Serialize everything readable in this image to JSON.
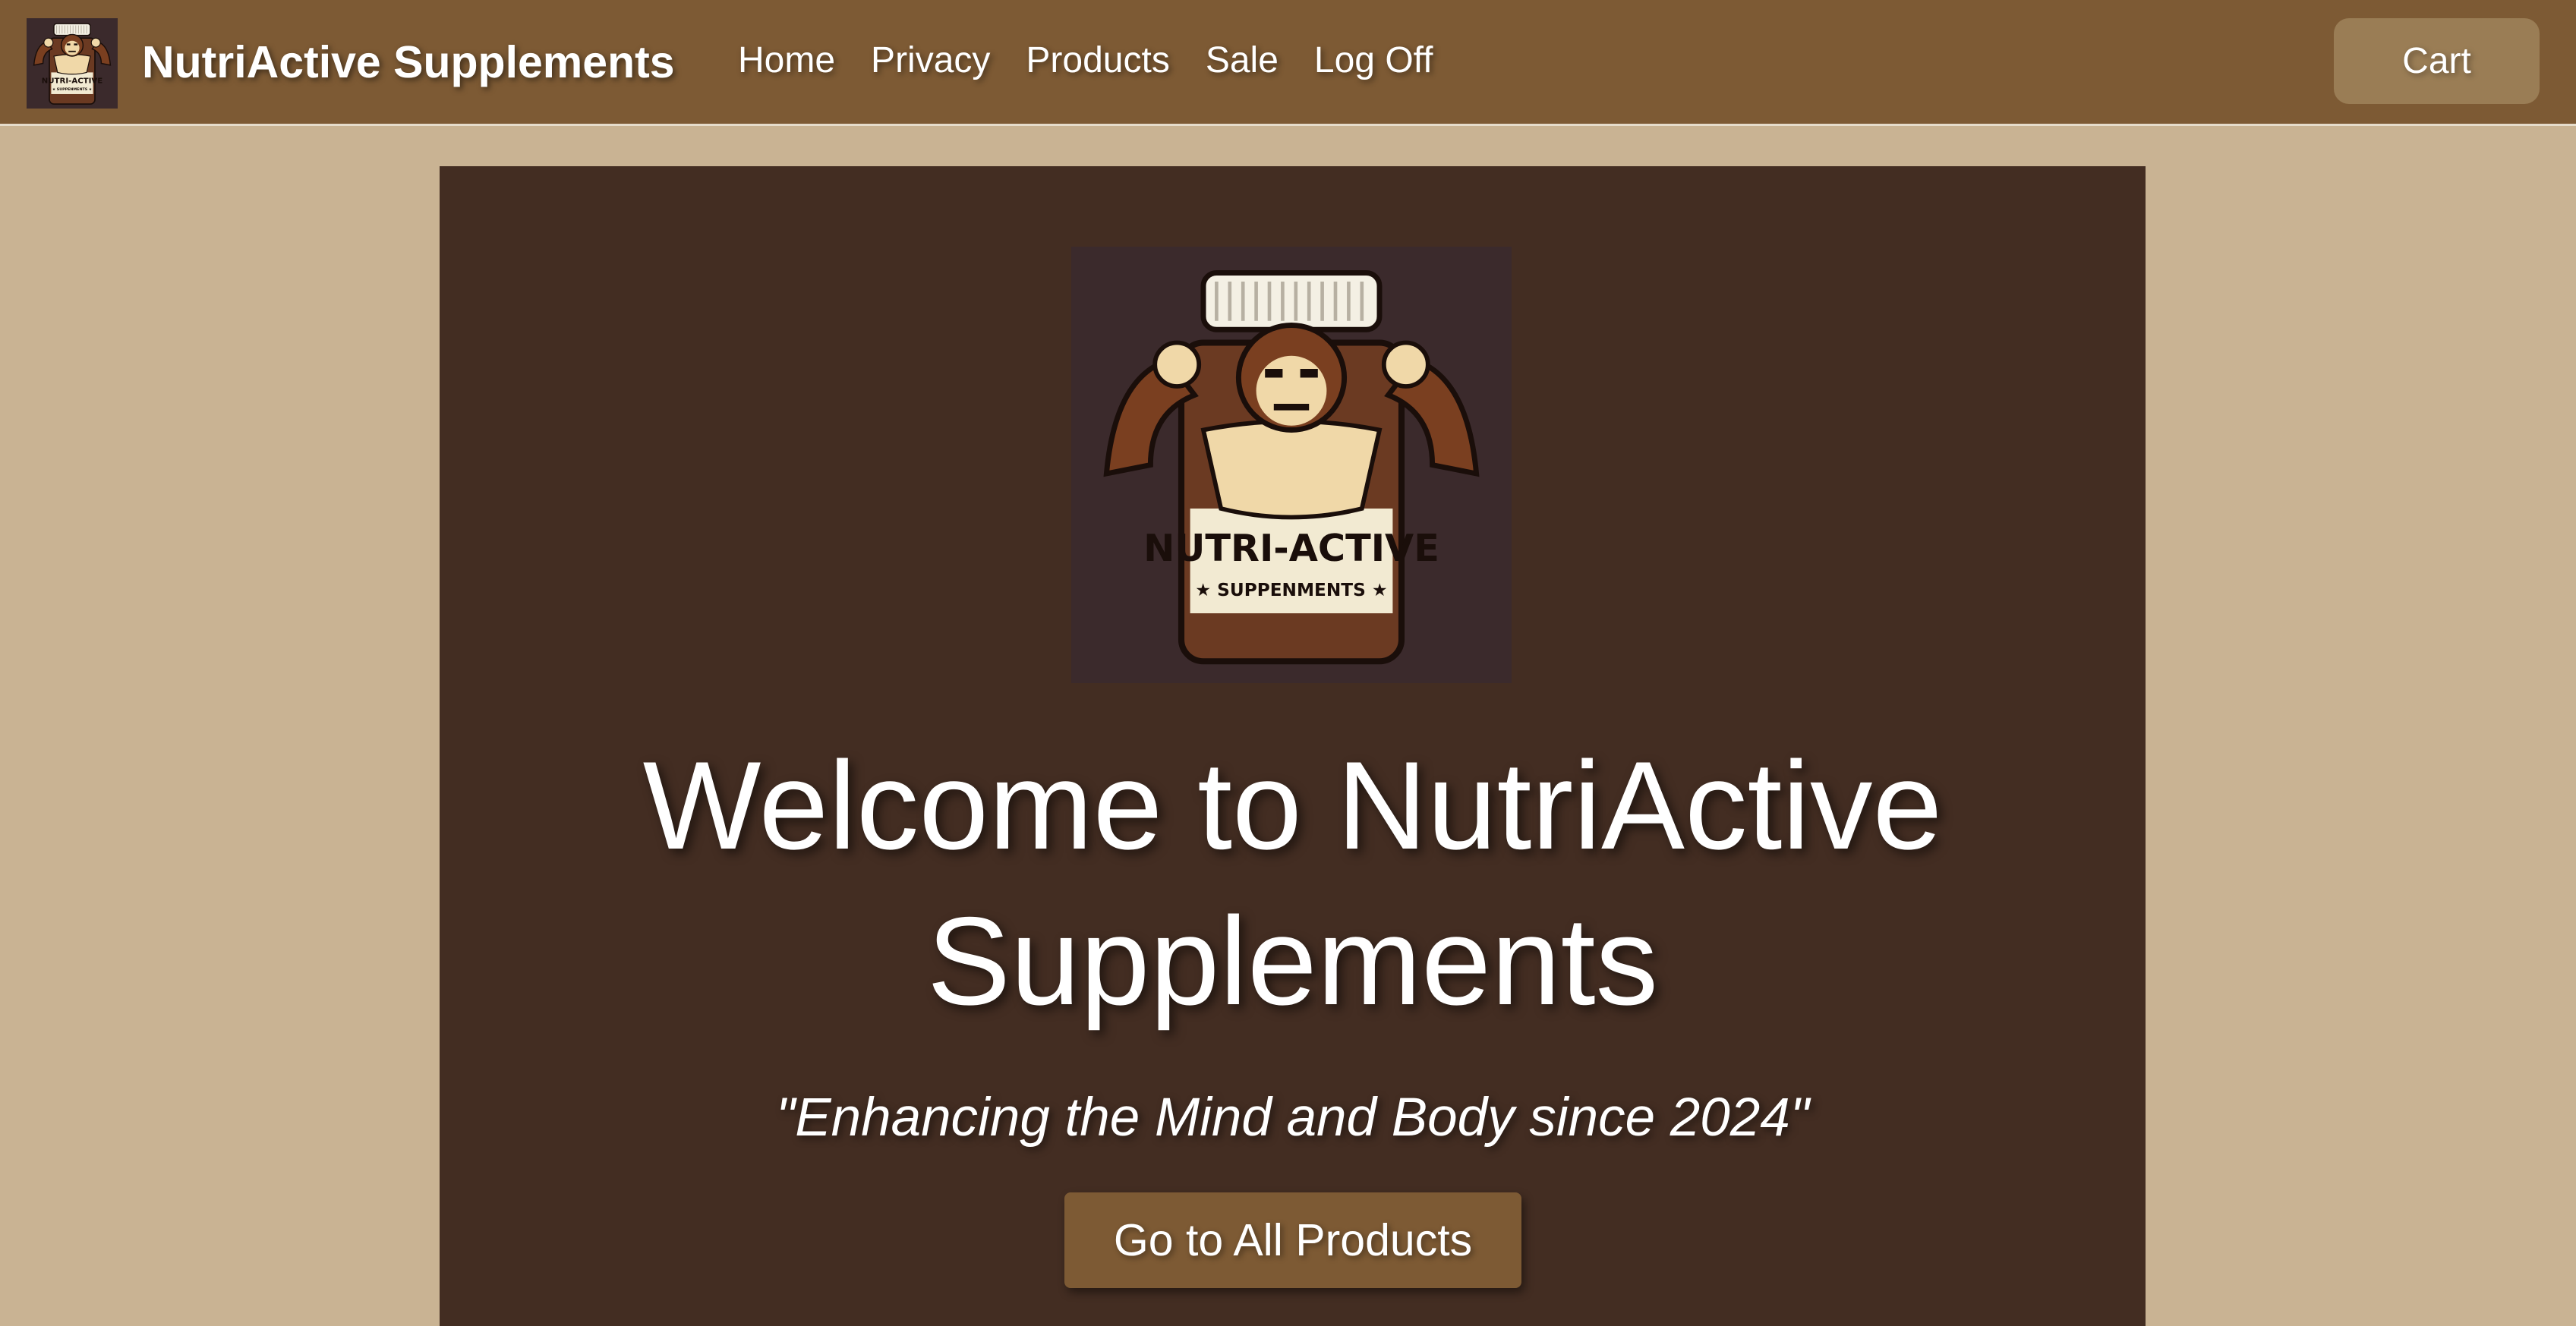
{
  "navbar": {
    "brand": "NutriActive Supplements",
    "logo_icon": "muscle-ape-jar-logo-icon",
    "links": [
      {
        "label": "Home"
      },
      {
        "label": "Privacy"
      },
      {
        "label": "Products"
      },
      {
        "label": "Sale"
      },
      {
        "label": "Log Off"
      }
    ],
    "cart_label": "Cart"
  },
  "hero": {
    "logo_icon": "muscle-ape-jar-logo-icon",
    "logo_text": {
      "line1": "NUTRI-ACTIVE",
      "line2": "SUPPENMENTS"
    },
    "title": "Welcome to NutriActive Supplements",
    "tagline": "\"Enhancing the Mind and Body since 2024\"",
    "cta_label": "Go to All Products"
  },
  "colors": {
    "page_background": "#c9b393",
    "navbar_background": "#7d5a34",
    "cart_button": "#9a7d55",
    "hero_background": "#432d22",
    "logo_background": "#3b2a2c",
    "text": "#ffffff"
  }
}
